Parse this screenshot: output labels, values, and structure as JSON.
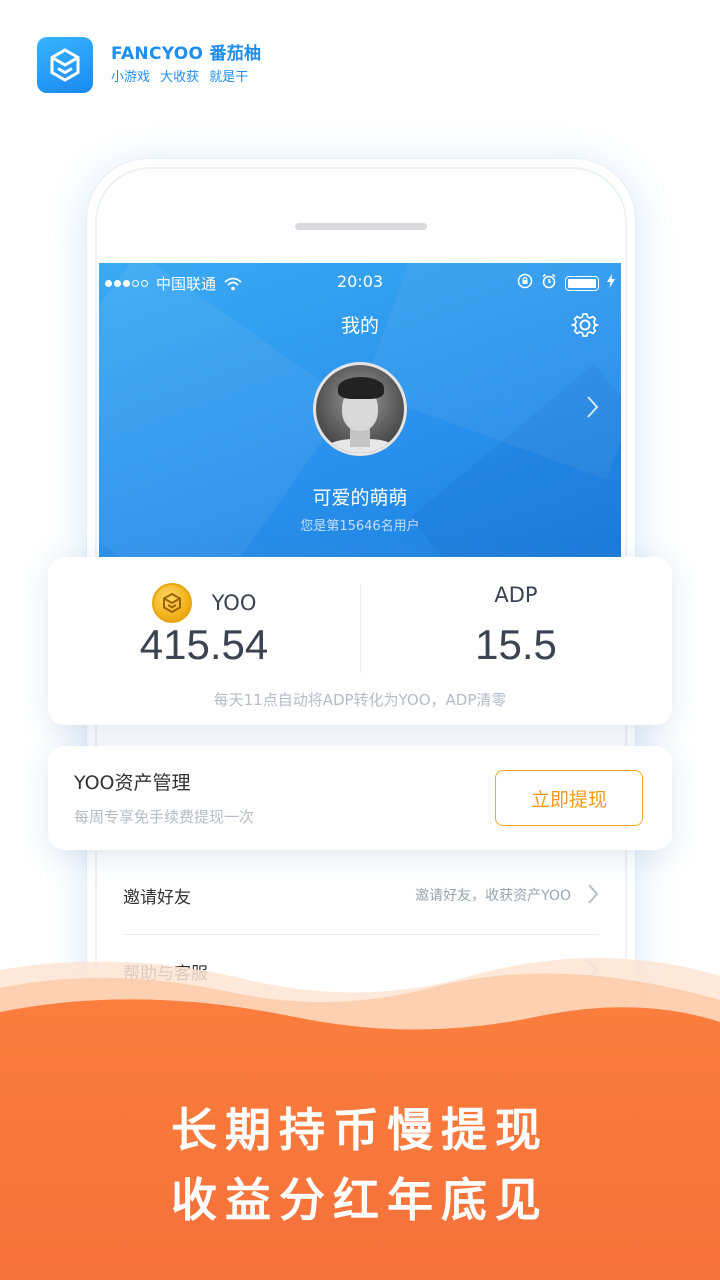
{
  "brand": {
    "name": "FANCYOO 番茄柚",
    "slogan": "小游戏 大收获 就是干",
    "logo_icon": "hexagon-cube-icon"
  },
  "status_bar": {
    "carrier": "中国联通",
    "time": "20:03",
    "signal_bars": 3,
    "signal_total": 5
  },
  "profile": {
    "title": "我的",
    "username": "可爱的萌萌",
    "user_number": "您是第15646名用户"
  },
  "balances": {
    "yoo_label": "YOO",
    "yoo_value": "415.54",
    "adp_label": "ADP",
    "adp_value": "15.5",
    "note": "每天11点自动将ADP转化为YOO，ADP清零"
  },
  "asset": {
    "title": "YOO资产管理",
    "subtitle": "每周专享免手续费提现一次",
    "withdraw_label": "立即提现"
  },
  "menu": [
    {
      "label": "邀请好友",
      "sub": "邀请好友，收获资产YOO"
    },
    {
      "label": "帮助与客服",
      "sub": ""
    }
  ],
  "banner": {
    "line1": "长期持币慢提现",
    "line2": "收益分红年底见"
  },
  "colors": {
    "primary_blue": "#2a92ec",
    "accent_orange": "#f39a1d",
    "banner_orange": "#f97b3d"
  }
}
